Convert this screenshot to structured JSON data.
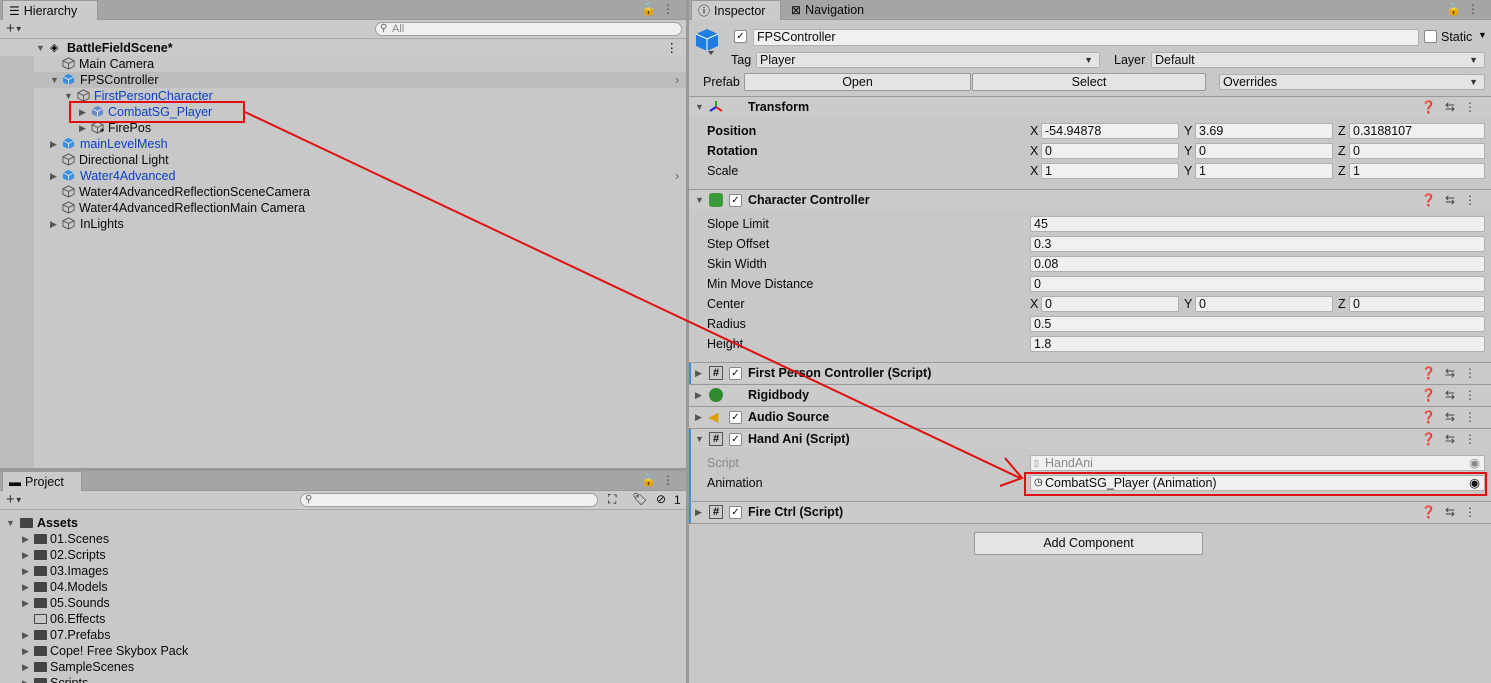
{
  "hierarchy": {
    "tab": "Hierarchy",
    "search_placeholder": "All",
    "scene": "BattleFieldScene*",
    "items": [
      {
        "label": "Main Camera"
      },
      {
        "label": "FPSController"
      },
      {
        "label": "FirstPersonCharacter"
      },
      {
        "label": "CombatSG_Player"
      },
      {
        "label": "FirePos"
      },
      {
        "label": "mainLevelMesh"
      },
      {
        "label": "Directional Light"
      },
      {
        "label": "Water4Advanced"
      },
      {
        "label": "Water4AdvancedReflectionSceneCamera"
      },
      {
        "label": "Water4AdvancedReflectionMain Camera"
      },
      {
        "label": "InLights"
      }
    ]
  },
  "project": {
    "tab": "Project",
    "hidden_count": "1",
    "root": "Assets",
    "folders": [
      "01.Scenes",
      "02.Scripts",
      "03.Images",
      "04.Models",
      "05.Sounds",
      "06.Effects",
      "07.Prefabs",
      "Cope! Free Skybox Pack",
      "SampleScenes",
      "Scripts"
    ]
  },
  "inspector": {
    "tab": "Inspector",
    "tab2": "Navigation",
    "object_name": "FPSController",
    "static_label": "Static",
    "tag_label": "Tag",
    "tag_value": "Player",
    "layer_label": "Layer",
    "layer_value": "Default",
    "prefab_label": "Prefab",
    "open_btn": "Open",
    "select_btn": "Select",
    "overrides": "Overrides",
    "transform": {
      "title": "Transform",
      "position_label": "Position",
      "rotation_label": "Rotation",
      "scale_label": "Scale",
      "x": "X",
      "y": "Y",
      "z": "Z",
      "position": [
        "-54.94878",
        "3.69",
        "0.3188107"
      ],
      "rotation": [
        "0",
        "0",
        "0"
      ],
      "scale": [
        "1",
        "1",
        "1"
      ]
    },
    "character_controller": {
      "title": "Character Controller",
      "fields": [
        {
          "label": "Slope Limit",
          "value": "45"
        },
        {
          "label": "Step Offset",
          "value": "0.3"
        },
        {
          "label": "Skin Width",
          "value": "0.08"
        },
        {
          "label": "Min Move Distance",
          "value": "0"
        }
      ],
      "center_label": "Center",
      "center": [
        "0",
        "0",
        "0"
      ],
      "radius_label": "Radius",
      "radius": "0.5",
      "height_label": "Height",
      "height": "1.8"
    },
    "fpc_title": "First Person Controller (Script)",
    "rigidbody_title": "Rigidbody",
    "audio_title": "Audio Source",
    "handani": {
      "title": "Hand Ani (Script)",
      "script_label": "Script",
      "script_value": "HandAni",
      "animation_label": "Animation",
      "animation_value": "CombatSG_Player (Animation)"
    },
    "firectrl_title": "Fire Ctrl (Script)",
    "add_component": "Add Component"
  },
  "colors": {
    "selection_blue": "#0b40c8",
    "annotation_red": "#e01010",
    "panel_bg": "#c8c8c8"
  }
}
